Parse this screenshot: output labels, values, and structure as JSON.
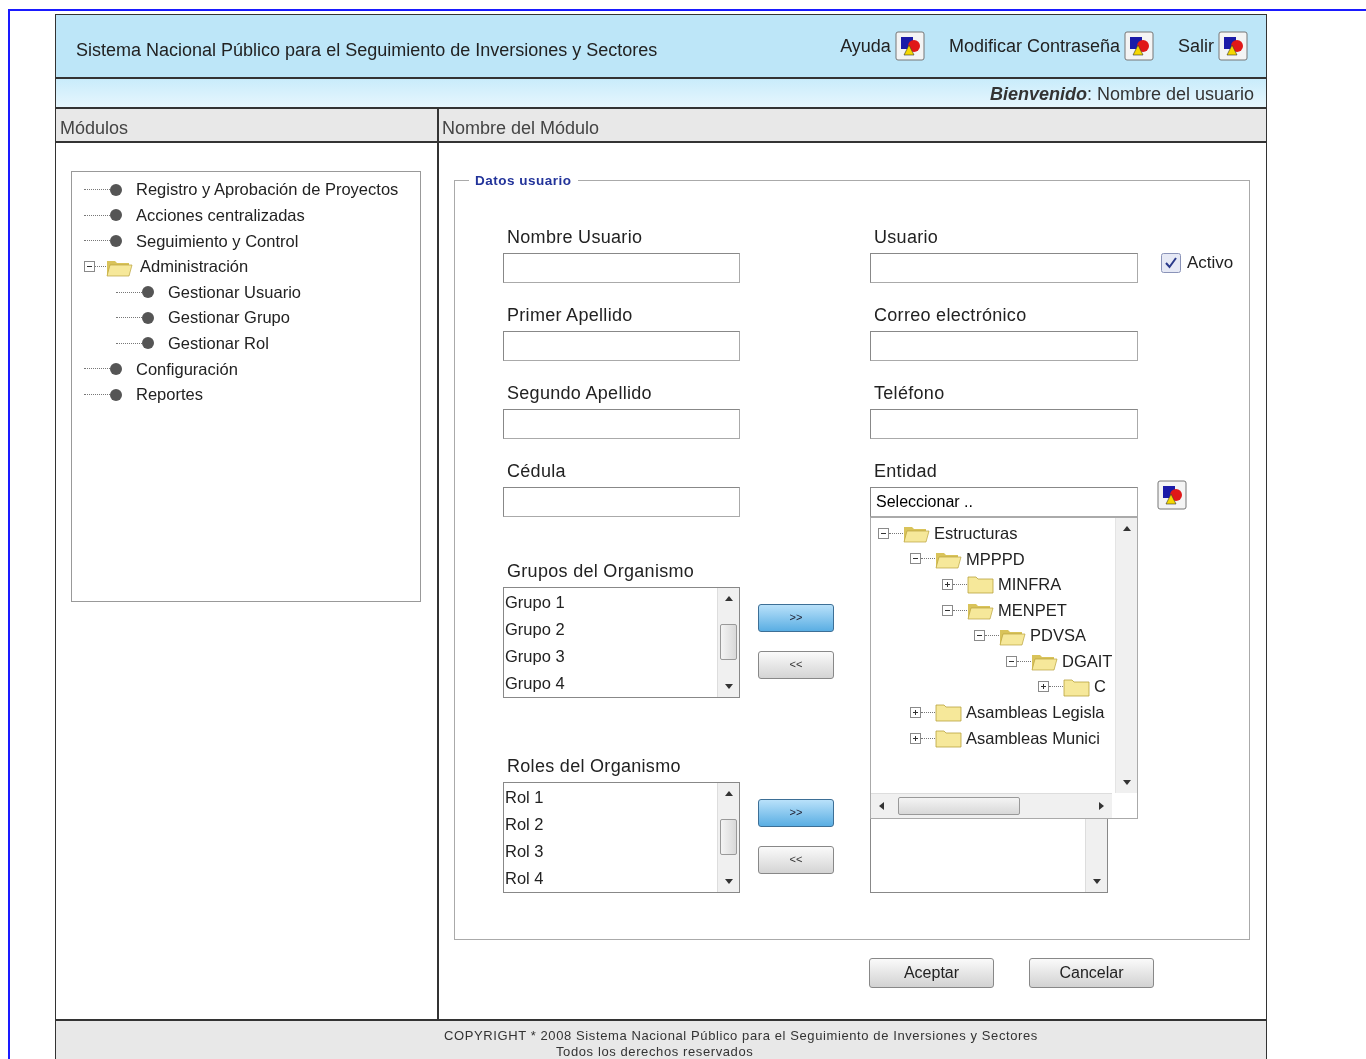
{
  "header": {
    "title": "Sistema Nacional Público para el Seguimiento de Inversiones y Sectores",
    "links": [
      {
        "label": "Ayuda"
      },
      {
        "label": "Modificar Contraseña"
      },
      {
        "label": "Salir"
      }
    ],
    "welcome": "**Bienvenido**: Nombre del usuario"
  },
  "sidebar": {
    "title": "Módulos",
    "items": [
      {
        "label": "Registro y Aprobación de Proyectos"
      },
      {
        "label": "Acciones centralizadas"
      },
      {
        "label": "Seguimiento y Control"
      },
      {
        "label": "Administración",
        "expanded": true,
        "children": [
          {
            "label": "Gestionar Usuario"
          },
          {
            "label": "Gestionar Grupo"
          },
          {
            "label": "Gestionar Rol"
          }
        ]
      },
      {
        "label": "Configuración"
      },
      {
        "label": "Reportes"
      }
    ]
  },
  "module": {
    "title": "Nombre del Módulo"
  },
  "form": {
    "legend": "Datos usuario",
    "rows": [
      {
        "left": {
          "label": "Nombre Usuario"
        },
        "right": {
          "label": "Usuario"
        }
      },
      {
        "left": {
          "label": "Primer Apellido"
        },
        "right": {
          "label": "Correo electrónico"
        }
      },
      {
        "left": {
          "label": "Segundo Apellido"
        },
        "right": {
          "label": "Teléfono"
        }
      },
      {
        "left": {
          "label": "Cédula"
        },
        "right": {
          "label": "Entidad",
          "value": "Seleccionar .."
        }
      }
    ],
    "active": {
      "label": "Activo",
      "checked": true
    },
    "entity_tree": [
      {
        "label": "Estructuras",
        "expanded": true,
        "children": [
          {
            "label": "MPPPD",
            "expanded": true,
            "children": [
              {
                "label": "MINFRA",
                "expanded": false
              },
              {
                "label": "MENPET",
                "expanded": true,
                "children": [
                  {
                    "label": "PDVSA",
                    "expanded": true,
                    "children": [
                      {
                        "label": "DGAIT",
                        "expanded": true,
                        "children": [
                          {
                            "label": "C",
                            "expanded": false
                          }
                        ]
                      }
                    ]
                  }
                ]
              }
            ]
          },
          {
            "label": "Asambleas Legisla",
            "expanded": false
          },
          {
            "label": "Asambleas Munici",
            "expanded": false
          }
        ]
      }
    ],
    "lists": [
      {
        "label": "Grupos del Organismo",
        "items": [
          "Grupo 1",
          "Grupo 2",
          "Grupo 3",
          "Grupo 4"
        ],
        "transfer": [
          {
            "label": ">>",
            "highlighted": true
          },
          {
            "label": "<<",
            "highlighted": false
          }
        ]
      },
      {
        "label": "Roles del Organismo",
        "items": [
          "Rol 1",
          "Rol 2",
          "Rol 3",
          "Rol 4"
        ],
        "transfer": [
          {
            "label": ">>",
            "highlighted": true
          },
          {
            "label": "<<",
            "highlighted": false
          }
        ]
      }
    ],
    "buttons": [
      "Aceptar",
      "Cancelar"
    ]
  },
  "footer": [
    "COPYRIGHT * 2008 Sistema Nacional Público para el Seguimiento de Inversiones y Sectores",
    "Todos los derechos reservados"
  ]
}
